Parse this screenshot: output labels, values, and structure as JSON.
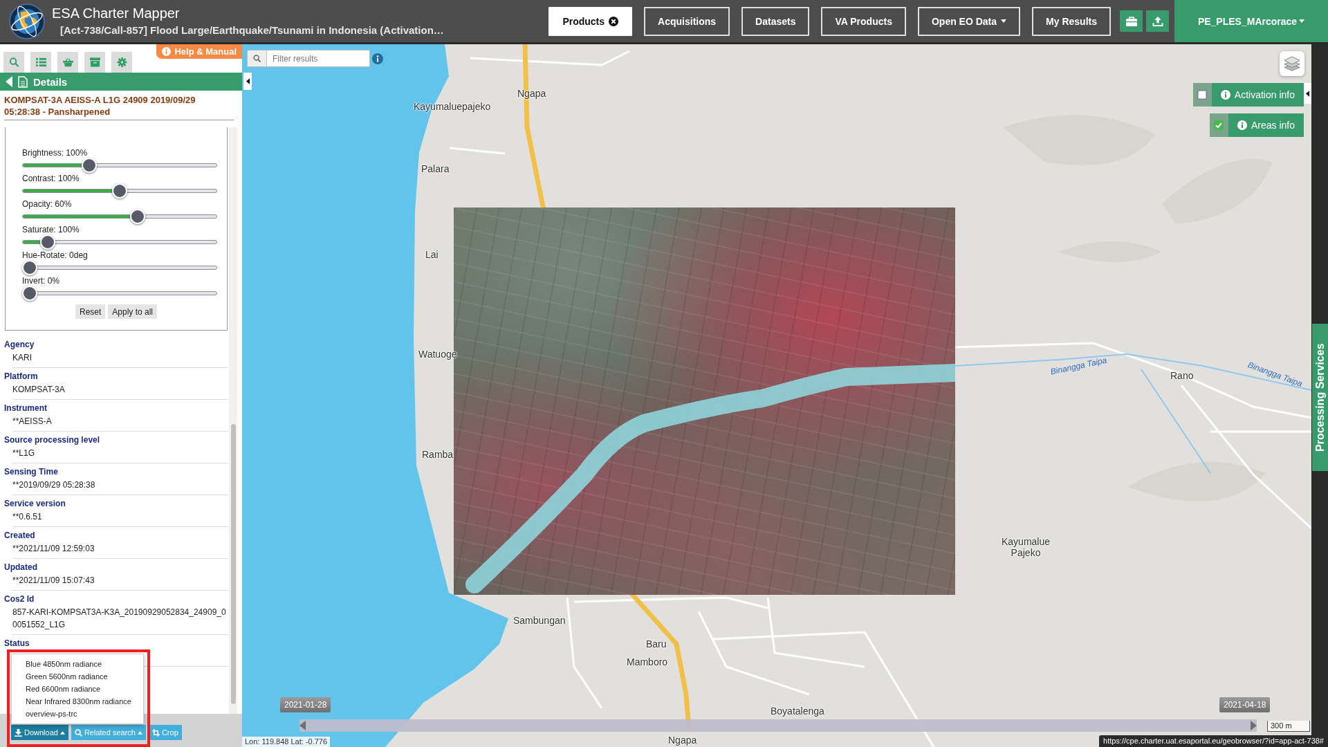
{
  "header": {
    "app_title": "ESA Charter Mapper",
    "subtitle": "[Act-738/Call-857] Flood Large/Earthquake/Tsunami in Indonesia (Activation…"
  },
  "nav_tabs": [
    {
      "label": "Products",
      "selected": true,
      "closable": true,
      "dropdown": false
    },
    {
      "label": "Acquisitions",
      "selected": false,
      "closable": false,
      "dropdown": false
    },
    {
      "label": "Datasets",
      "selected": false,
      "closable": false,
      "dropdown": false
    },
    {
      "label": "VA Products",
      "selected": false,
      "closable": false,
      "dropdown": false
    },
    {
      "label": "Open EO Data",
      "selected": false,
      "closable": false,
      "dropdown": true
    },
    {
      "label": "My Results",
      "selected": false,
      "closable": false,
      "dropdown": false
    }
  ],
  "user_menu": {
    "label": "PE_PLES_MArcorace"
  },
  "sidebar": {
    "help_link": "Help & Manual",
    "panel_title": "Details",
    "product_title": "KOMPSAT-3A AEISS-A L1G 24909 2019/09/29 05:28:38 - Pansharpened",
    "filters": [
      {
        "label": "Brightness: 100%",
        "level": 0.33
      },
      {
        "label": "Contrast: 100%",
        "level": 0.5
      },
      {
        "label": "Opacity: 60%",
        "level": 0.6
      },
      {
        "label": "Saturate: 100%",
        "level": 0.1
      },
      {
        "label": "Hue-Rotate: 0deg",
        "level": 0
      },
      {
        "label": "Invert: 0%",
        "level": 0
      }
    ],
    "filter_buttons": [
      "Reset",
      "Apply to all"
    ],
    "properties": [
      {
        "label": "Agency",
        "value": "KARI"
      },
      {
        "label": "Platform",
        "value": "KOMPSAT-3A"
      },
      {
        "label": "Instrument",
        "value": "**AEISS-A"
      },
      {
        "label": "Source processing level",
        "value": "**L1G"
      },
      {
        "label": "Sensing Time",
        "value": "**2019/09/29 05:28:38"
      },
      {
        "label": "Service version",
        "value": "**0.6.51"
      },
      {
        "label": "Created",
        "value": "**2021/11/09 12:59:03"
      },
      {
        "label": "Updated",
        "value": "**2021/11/09 15:07:43"
      },
      {
        "label": "Cos2 Id",
        "value": "857-KARI-KOMPSAT3A-K3A_20190929052834_24909_00051552_L1G"
      },
      {
        "label": "Status"
      }
    ],
    "download_menu": [
      "Blue 4850nm radiance",
      "Green 5600nm radiance",
      "Red 6600nm radiance",
      "Near Infrared 8300nm radiance",
      "overview-ps-trc"
    ],
    "actions": [
      {
        "label": "Download",
        "kind": "download",
        "open": true,
        "dropdown": true
      },
      {
        "label": "Related search",
        "kind": "search",
        "open": false,
        "dropdown": true
      },
      {
        "label": "Crop",
        "kind": "crop",
        "open": false,
        "dropdown": false
      }
    ]
  },
  "map": {
    "search": {
      "placeholder": "Filter results"
    },
    "overlays": [
      {
        "label": "Activation info",
        "checked": false
      },
      {
        "label": "Areas info",
        "checked": true
      }
    ],
    "labels": [
      {
        "text": "Ngapa",
        "kind": "place"
      },
      {
        "text": "Kayumaluepajeko",
        "kind": "place"
      },
      {
        "text": "Palara",
        "kind": "place"
      },
      {
        "text": "Lai",
        "kind": "place"
      },
      {
        "text": "Watuoge",
        "kind": "place"
      },
      {
        "text": "Binangga Taipa",
        "kind": "river"
      },
      {
        "text": "Rano",
        "kind": "place"
      },
      {
        "text": "Binangga Taipa",
        "kind": "river"
      },
      {
        "text": "Ramba",
        "kind": "place"
      },
      {
        "text": "Kayumalue Pajeko",
        "kind": "place"
      },
      {
        "text": "Sambungan",
        "kind": "place"
      },
      {
        "text": "Baru",
        "kind": "place"
      },
      {
        "text": "Mamboro",
        "kind": "place"
      },
      {
        "text": "Boyatalenga",
        "kind": "place"
      },
      {
        "text": "Ngapa",
        "kind": "place"
      }
    ],
    "timeline": {
      "start": "2021-01-28",
      "end": "2021-04-18"
    },
    "scale": "300 m",
    "coordinates": "Lon: 119.848 Lat: -0.776"
  },
  "side_tab": "Processing Services",
  "status_url": "https://cpe.charter.uat.esaportal.eu/geobrowser/?id=app-act-738#"
}
